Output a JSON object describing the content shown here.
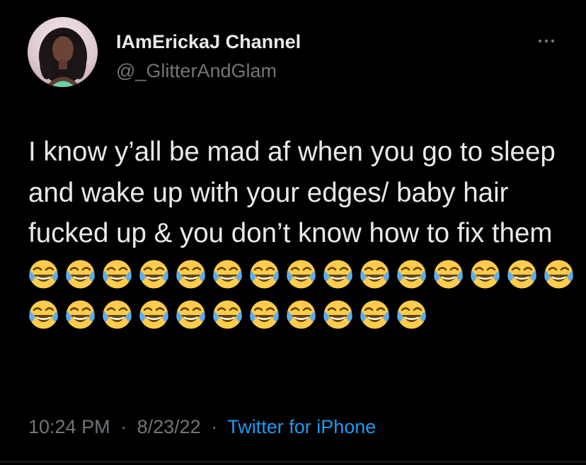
{
  "tweet": {
    "author": {
      "display_name": "IAmErickaJ Channel",
      "handle": "@_GlitterAndGlam"
    },
    "text": "I know y’all be mad af when you go to sleep and wake up with your edges/ baby hair fucked up & you don’t know how to fix them",
    "emoji": {
      "name": "face-with-tears-of-joy-icon",
      "count": 26
    },
    "timestamp": {
      "time": "10:24 PM",
      "separator": "·",
      "date": "8/23/22",
      "source": "Twitter for iPhone"
    },
    "more_icon": "more-horizontal-icon"
  },
  "colors": {
    "background": "#000000",
    "text_primary": "#e7e9ea",
    "text_secondary": "#71767b",
    "link": "#1d9bf0"
  }
}
